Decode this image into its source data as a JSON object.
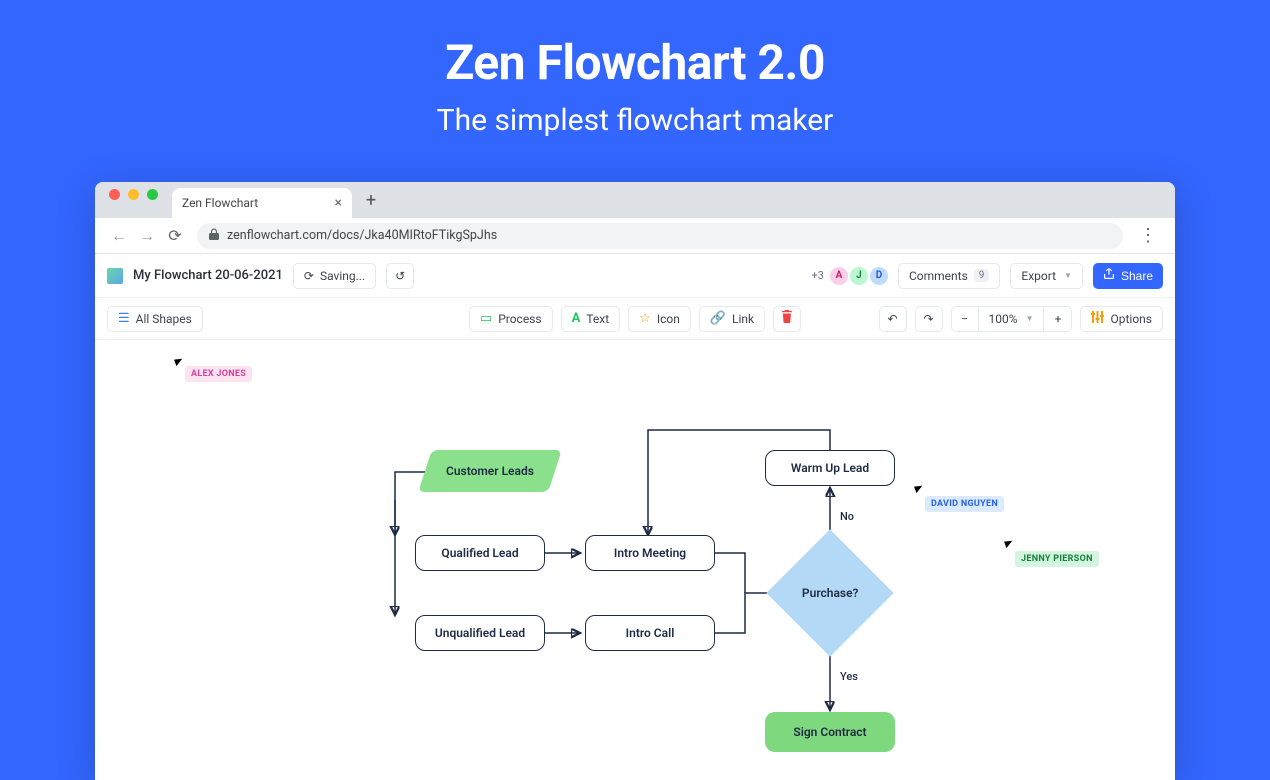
{
  "hero": {
    "title": "Zen Flowchart 2.0",
    "subtitle": "The simplest flowchart maker"
  },
  "browser": {
    "tab_title": "Zen Flowchart",
    "url": "zenflowchart.com/docs/Jka40MIRtoFTikgSpJhs"
  },
  "appbar": {
    "doc_title": "My Flowchart 20-06-2021",
    "saving_label": "Saving...",
    "avatars": {
      "more": "+3",
      "a": "A",
      "j": "J",
      "d": "D"
    },
    "comments_label": "Comments",
    "comments_count": "9",
    "export_label": "Export",
    "share_label": "Share"
  },
  "toolbar": {
    "shapes_label": "All Shapes",
    "process_label": "Process",
    "text_label": "Text",
    "icon_label": "Icon",
    "link_label": "Link",
    "zoom": "100%",
    "options_label": "Options"
  },
  "flow": {
    "nodes": {
      "start": "Customer Leads",
      "qualified": "Qualified Lead",
      "unqualified": "Unqualified Lead",
      "meeting": "Intro Meeting",
      "call": "Intro Call",
      "warmup": "Warm Up Lead",
      "purchase": "Purchase?",
      "sign": "Sign Contract"
    },
    "labels": {
      "no": "No",
      "yes": "Yes"
    }
  },
  "cursors": {
    "alex": "ALEX JONES",
    "david": "DAVID NGUYEN",
    "jenny": "JENNY PIERSON"
  },
  "colors": {
    "alex_bg": "#fde3ef",
    "alex_fg": "#d6409f",
    "david_bg": "#dbeafe",
    "david_fg": "#2563eb",
    "jenny_bg": "#d4f5dd",
    "jenny_fg": "#15803d"
  }
}
